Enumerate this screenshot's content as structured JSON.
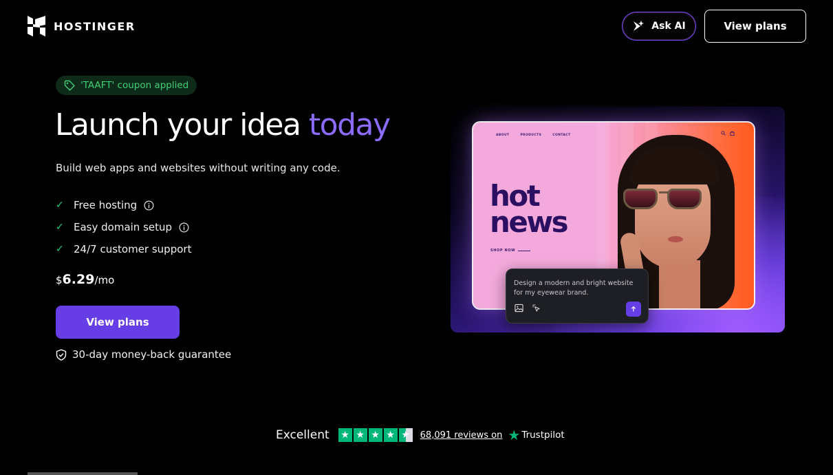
{
  "header": {
    "brand": "HOSTINGER",
    "ask_ai_label": "Ask AI",
    "view_plans_label": "View plans"
  },
  "hero": {
    "coupon": "'TAAFT' coupon applied",
    "headline_main": "Launch your idea ",
    "headline_accent": "today",
    "subtitle": "Build web apps and websites without writing any code.",
    "features": [
      {
        "label": "Free hosting",
        "has_info": true
      },
      {
        "label": "Easy domain setup",
        "has_info": true
      },
      {
        "label": "24/7 customer support",
        "has_info": false
      }
    ],
    "price": {
      "currency": "$",
      "amount": "6.29",
      "period": "/mo"
    },
    "cta_label": "View plans",
    "guarantee": "30-day money-back guarantee"
  },
  "mockup": {
    "nav": [
      "ABOUT",
      "PRODUCTS",
      "CONTACT"
    ],
    "title_line1": "hot",
    "title_line2": "news",
    "shop_now": "SHOP NOW",
    "prompt_text": "Design a modern and bright website for my eyewear brand."
  },
  "trustpilot": {
    "rating_word": "Excellent",
    "stars": 4.5,
    "reviews_link": "68,091 reviews on",
    "brand": "Trustpilot"
  },
  "colors": {
    "accent_purple": "#673de6",
    "headline_accent": "#8c6cff",
    "coupon_green": "#3fd178",
    "trustpilot_green": "#00b67a"
  }
}
